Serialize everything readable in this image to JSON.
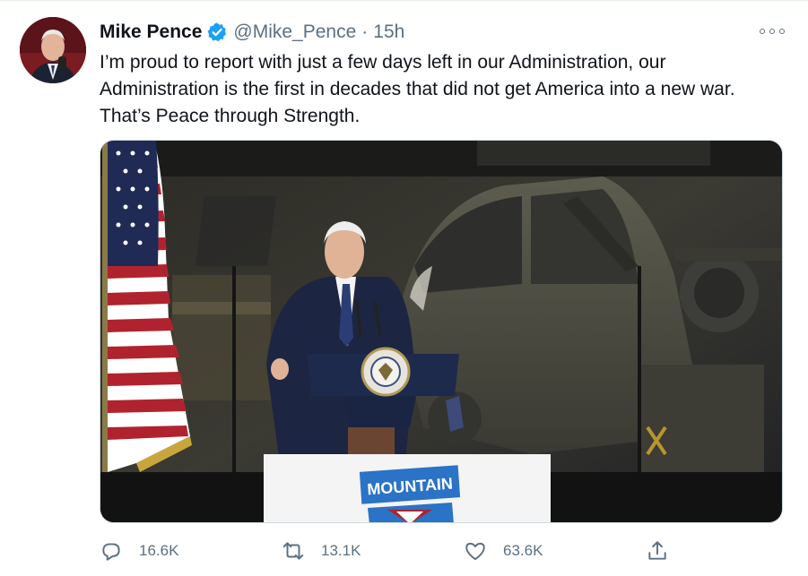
{
  "tweet": {
    "display_name": "Mike Pence",
    "handle": "@Mike_Pence",
    "separator": "·",
    "time": "15h",
    "verified_icon": "verified-badge-icon",
    "more_icon": "more-options-icon",
    "text": "I’m proud to report with just a few days left in our Administration, our Administration is the first in decades that did not get America into a new war. That’s Peace through Strength.",
    "media": {
      "podium_sign": "MOUNTAIN"
    },
    "actions": {
      "reply_count": "16.6K",
      "retweet_count": "13.1K",
      "like_count": "63.6K",
      "reply_icon": "reply-icon",
      "retweet_icon": "retweet-icon",
      "like_icon": "heart-icon",
      "share_icon": "share-icon"
    }
  },
  "colors": {
    "verified": "#1da1f2",
    "secondary_text": "#5b7083",
    "primary_text": "#0f1419"
  }
}
